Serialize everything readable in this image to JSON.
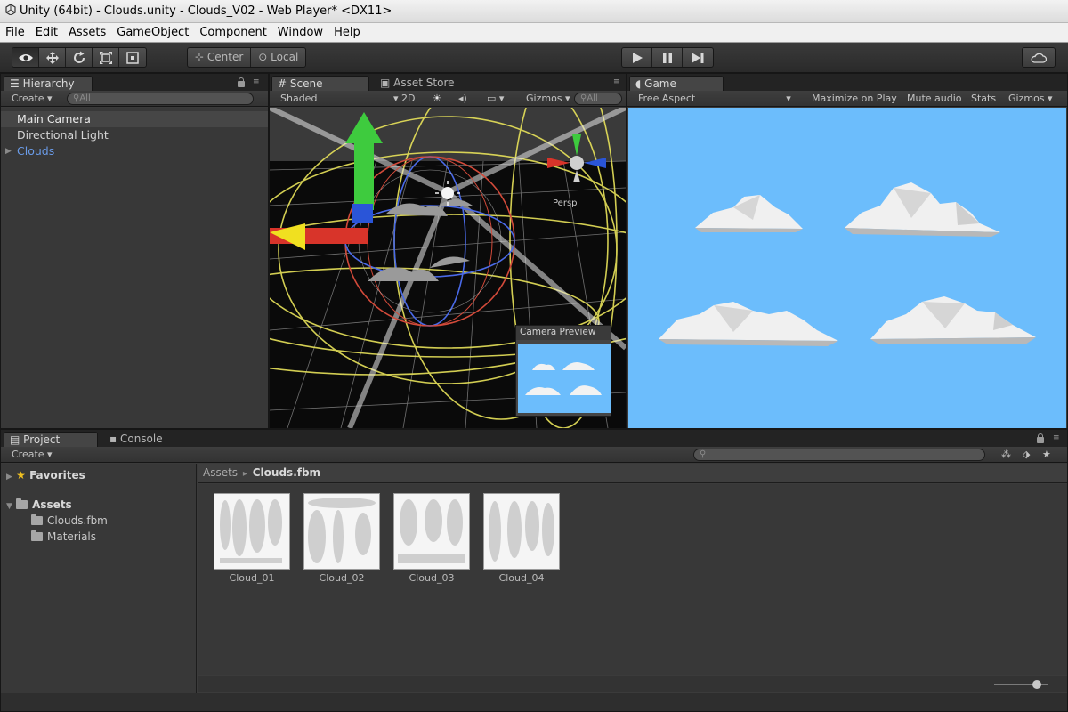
{
  "window": {
    "title": "Unity (64bit) - Clouds.unity - Clouds_V02 - Web Player* <DX11>"
  },
  "menu": [
    "File",
    "Edit",
    "Assets",
    "GameObject",
    "Component",
    "Window",
    "Help"
  ],
  "toolbar": {
    "tools": [
      "view-tool",
      "move-tool",
      "rotate-tool",
      "scale-tool",
      "rect-tool"
    ],
    "pivot": "Center",
    "space": "Local",
    "play_controls": [
      "play",
      "pause",
      "step"
    ]
  },
  "hierarchy": {
    "tab": "Hierarchy",
    "create": "Create",
    "search_placeholder": "All",
    "items": [
      {
        "label": "Main Camera",
        "selected": true
      },
      {
        "label": "Directional Light",
        "selected": false
      },
      {
        "label": "Clouds",
        "selected": false,
        "prefab": true
      }
    ]
  },
  "scene": {
    "tab": "Scene",
    "tab2": "Asset Store",
    "shading": "Shaded",
    "mode2d": "2D",
    "gizmos": "Gizmos",
    "search_placeholder": "All",
    "persp_label": "Persp",
    "camera_preview_title": "Camera Preview"
  },
  "game": {
    "tab": "Game",
    "aspect": "Free Aspect",
    "maximize": "Maximize on Play",
    "mute": "Mute audio",
    "stats": "Stats",
    "gizmos": "Gizmos",
    "sky_color": "#6cbdfc"
  },
  "project": {
    "tab": "Project",
    "tab2": "Console",
    "create": "Create",
    "favorites": "Favorites",
    "assets_root": "Assets",
    "folders": [
      "Clouds.fbm",
      "Materials"
    ],
    "breadcrumb": {
      "root": "Assets",
      "separator": "▸",
      "current": "Clouds.fbm"
    },
    "files": [
      "Cloud_01",
      "Cloud_02",
      "Cloud_03",
      "Cloud_04"
    ]
  },
  "colors": {
    "selection_blue": "#5a8bd6",
    "accent_yellow": "#e8e35a"
  }
}
